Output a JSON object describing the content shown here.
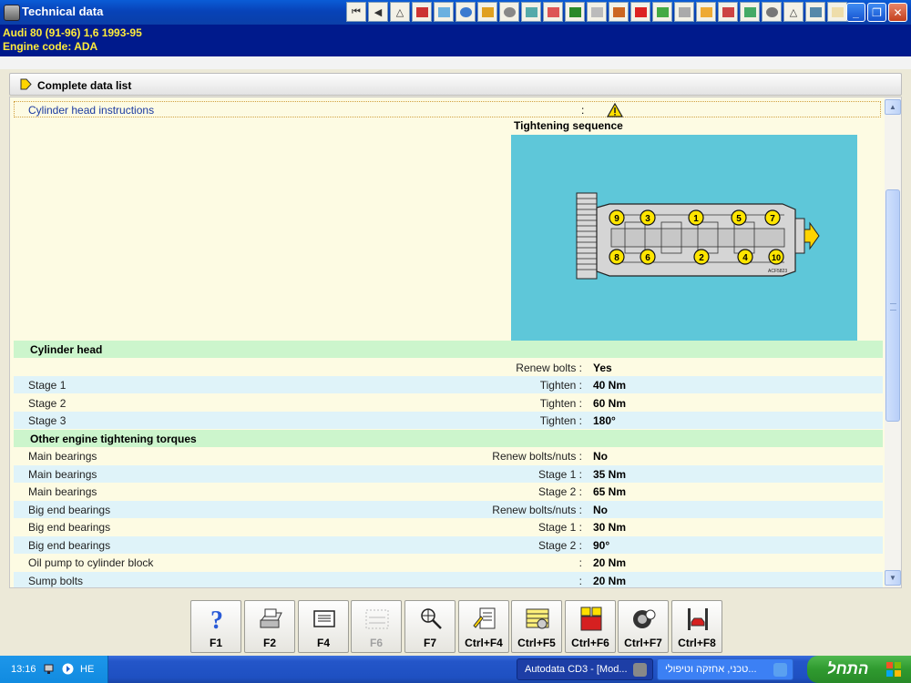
{
  "window": {
    "title": "Technical data"
  },
  "vehicle": {
    "line1": "Audi  80 (91-96) 1,6  1993-95",
    "line2": "Engine code: ADA"
  },
  "section": {
    "title": "Complete data list"
  },
  "instructions": {
    "label": "Cylinder head instructions",
    "colon": ":"
  },
  "diagram": {
    "title": "Tightening sequence",
    "code": "ACF5823",
    "bolts_top": [
      "9",
      "3",
      "1",
      "5",
      "7"
    ],
    "bolts_bottom": [
      "8",
      "6",
      "2",
      "4",
      "10"
    ]
  },
  "rows": [
    {
      "type": "group",
      "label": "Cylinder head"
    },
    {
      "type": "data",
      "label": "",
      "key": "Renew bolts :",
      "value": "Yes"
    },
    {
      "type": "data",
      "label": "Stage 1",
      "key": "Tighten :",
      "value": "40 Nm"
    },
    {
      "type": "data",
      "label": "Stage 2",
      "key": "Tighten :",
      "value": "60 Nm"
    },
    {
      "type": "data",
      "label": "Stage 3",
      "key": "Tighten :",
      "value": "180°"
    },
    {
      "type": "group",
      "label": "Other engine tightening torques"
    },
    {
      "type": "data",
      "label": "Main bearings",
      "key": "Renew bolts/nuts :",
      "value": "No"
    },
    {
      "type": "data",
      "label": "Main bearings",
      "key": "Stage 1 :",
      "value": "35 Nm"
    },
    {
      "type": "data",
      "label": "Main bearings",
      "key": "Stage 2 :",
      "value": "65 Nm"
    },
    {
      "type": "data",
      "label": "Big end bearings",
      "key": "Renew bolts/nuts :",
      "value": "No"
    },
    {
      "type": "data",
      "label": "Big end bearings",
      "key": "Stage 1 :",
      "value": "30 Nm"
    },
    {
      "type": "data",
      "label": "Big end bearings",
      "key": "Stage 2 :",
      "value": "90°"
    },
    {
      "type": "data",
      "label": "Oil pump to cylinder block",
      "key": ":",
      "value": "20 Nm"
    },
    {
      "type": "data",
      "label": "Sump bolts",
      "key": ":",
      "value": "20 Nm"
    }
  ],
  "fkeys": [
    {
      "label": "F1",
      "icon": "help-icon"
    },
    {
      "label": "F2",
      "icon": "printer-icon"
    },
    {
      "label": "F4",
      "icon": "screen-icon"
    },
    {
      "label": "F6",
      "icon": "text-search-icon",
      "disabled": true
    },
    {
      "label": "F7",
      "icon": "zoom-icon"
    },
    {
      "label": "Ctrl+F4",
      "icon": "notes-icon"
    },
    {
      "label": "Ctrl+F5",
      "icon": "table-icon"
    },
    {
      "label": "Ctrl+F6",
      "icon": "calculator-icon"
    },
    {
      "label": "Ctrl+F7",
      "icon": "wheel-icon"
    },
    {
      "label": "Ctrl+F8",
      "icon": "lift-icon"
    }
  ],
  "taskbar": {
    "clock": "13:16",
    "lang": "HE",
    "task1": "Autodata CD3 - [Mod...",
    "task2": "טכני, אחזקה וטיפולי...",
    "start": "התחל"
  },
  "colors": {
    "vehicle_bg": "#001a8c",
    "vehicle_text": "#ffeb3b",
    "diagram_bg": "#5ec7d9",
    "group_row": "#ccf5cc"
  }
}
